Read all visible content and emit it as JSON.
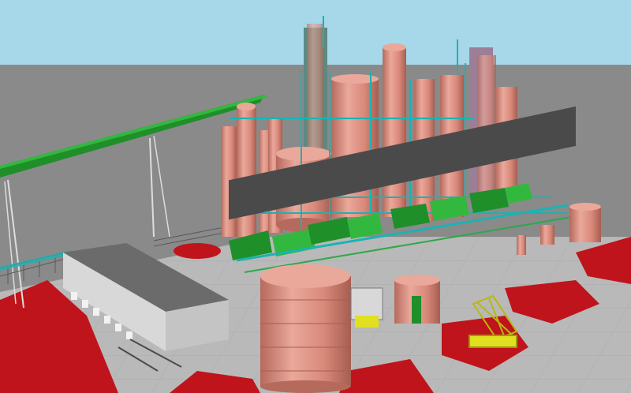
{
  "scene": {
    "kind": "3d-plant-model-render",
    "colors": {
      "sky": "#a7d8ea",
      "ground": "#8a8a8a",
      "ground_grid": "#a9a9a9",
      "red_pad": "#c0141c",
      "vessel": "#d9897a",
      "vessel_shade": "#b56a5c",
      "vessel_light": "#eaa89b",
      "equipment_green": "#1f8f2a",
      "equipment_green_light": "#33b83f",
      "pipe_cyan": "#1ab3b3",
      "steel": "#5a5a5a",
      "building_roof": "#6b6b6b",
      "building_wall": "#d8d8d8",
      "crane_yellow": "#e0e020"
    }
  }
}
